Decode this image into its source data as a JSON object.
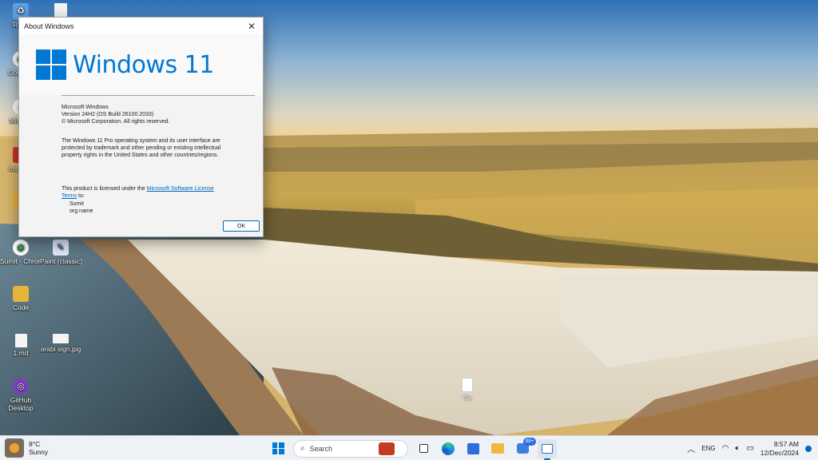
{
  "desktop_icons": [
    {
      "name": "recycle-bin-icon",
      "label": "Recy",
      "glyph": "♻",
      "color": "#5aa0e0"
    },
    {
      "name": "doc-icon",
      "label": "",
      "glyph": "",
      "color": "#f4f4f4"
    },
    {
      "name": "chrome-icon",
      "label": "Goo Chr",
      "glyph": "◉",
      "color": "#34a853"
    },
    {
      "name": "edge-icon",
      "label": "Micr Ed",
      "glyph": "◐",
      "color": "#1e88e5"
    },
    {
      "name": "installer-icon",
      "label": "Ins Dow",
      "glyph": "⬇",
      "color": "#cc3333"
    },
    {
      "name": "folder-icon",
      "label": "",
      "glyph": "",
      "color": "#e8b339"
    },
    {
      "name": "sumit-chrome-icon",
      "label": "Sumit - Chrome",
      "glyph": "◉",
      "color": "#34a853"
    },
    {
      "name": "paint-icon",
      "label": "Paint (classic)",
      "glyph": "✎",
      "color": "#4a7fd0"
    },
    {
      "name": "code-folder-icon",
      "label": "Code",
      "glyph": "",
      "color": "#e8b339"
    },
    {
      "name": "text-file-icon",
      "label": "1.md",
      "glyph": "",
      "color": "#f4f4f4"
    },
    {
      "name": "image-file-icon",
      "label": "arabi sign.jpg",
      "glyph": "",
      "color": "#f4f4f4"
    },
    {
      "name": "github-desktop-icon",
      "label": "GitHub Desktop",
      "glyph": "◎",
      "color": "#7b3fbf"
    },
    {
      "name": "pdf-file-icon",
      "label": "file",
      "glyph": "",
      "color": "#f4f4f4"
    }
  ],
  "dialog": {
    "title": "About Windows",
    "logo_text": "Windows 11",
    "product": "Microsoft Windows",
    "version": "Version 24H2 (OS Build 26100.2033)",
    "copyright": "© Microsoft Corporation. All rights reserved.",
    "legal": "The Windows 11 Pro operating system and its user interface are protected by trademark and other pending or existing intellectual property rights in the United States and other countries/regions.",
    "license_prefix": "This product is licensed under the ",
    "license_link": "Microsoft Software License Terms",
    "license_suffix": " to:",
    "user": "Sumit",
    "org": "org name",
    "ok_label": "OK"
  },
  "taskbar": {
    "weather_temp": "8°C",
    "weather_desc": "Sunny",
    "search_placeholder": "Search",
    "notification_badge": "99+",
    "language": "ENG",
    "time": "8:57 AM",
    "date": "12/Dec/2024",
    "accent": "#0067c0"
  }
}
